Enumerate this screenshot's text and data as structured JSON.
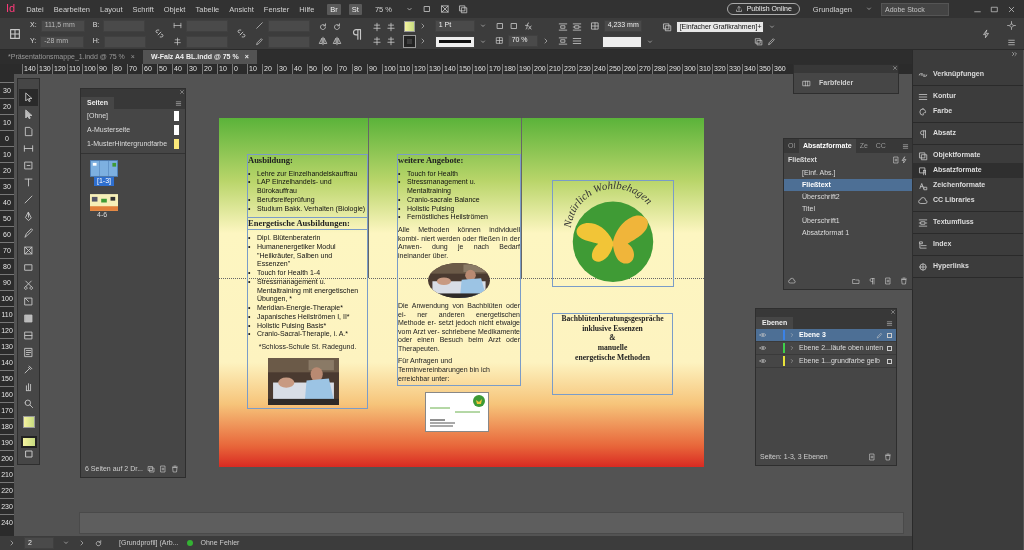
{
  "menu_bar": {
    "app_icon": "Id",
    "menus": [
      "Datei",
      "Bearbeiten",
      "Layout",
      "Schrift",
      "Objekt",
      "Tabelle",
      "Ansicht",
      "Fenster",
      "Hilfe"
    ],
    "bridge": "Br",
    "stock": "St",
    "zoom": "75 %",
    "publish": "Publish Online",
    "workspace": "Grundlagen",
    "search_placeholder": "Adobe Stock"
  },
  "control_bar": {
    "x_label": "X:",
    "x_value": "111,5 mm",
    "y_label": "Y:",
    "y_value": "-28 mm",
    "w_label": "B:",
    "h_label": "H:",
    "fields_disabled": true,
    "stroke_weight": "1 Pt",
    "opacity": "70 %",
    "offset": "4,233 mm",
    "object_style": "[Einfacher Grafikrahmen]+"
  },
  "document_tabs": [
    {
      "label": "*Präsentationsmappe_1.indd @ 75 %",
      "close": "×",
      "selected": false
    },
    {
      "label": "W-Falz A4 BL.indd @ 75 %",
      "close": "×",
      "selected": true
    }
  ],
  "rulers": {
    "horizontal": [
      "140",
      "130",
      "120",
      "110",
      "100",
      "90",
      "80",
      "70",
      "60",
      "50",
      "40",
      "30",
      "20",
      "10",
      "0",
      "10",
      "20",
      "30",
      "40",
      "50",
      "60",
      "70",
      "80",
      "90",
      "100",
      "110",
      "120",
      "130",
      "140",
      "150",
      "160",
      "170",
      "180",
      "190",
      "200",
      "210",
      "220",
      "230",
      "240",
      "250",
      "260",
      "270",
      "280",
      "290",
      "300",
      "310",
      "320",
      "330",
      "340",
      "350",
      "360"
    ],
    "vertical": [
      "30",
      "20",
      "10",
      "0",
      "10",
      "20",
      "30",
      "40",
      "50",
      "60",
      "70",
      "80",
      "90",
      "100",
      "110",
      "120",
      "130",
      "140",
      "150",
      "160",
      "170",
      "180",
      "190",
      "200",
      "210",
      "220",
      "230",
      "240"
    ]
  },
  "tools": [
    {
      "kind": "pointer",
      "selected": true
    },
    {
      "kind": "pointer-solid",
      "selected": false
    },
    {
      "kind": "page",
      "selected": false
    },
    {
      "kind": "gap",
      "selected": false
    },
    {
      "kind": "content",
      "selected": false
    },
    {
      "kind": "type",
      "selected": false
    },
    {
      "kind": "line",
      "selected": false
    },
    {
      "kind": "pen",
      "selected": false
    },
    {
      "kind": "pencil",
      "selected": false
    },
    {
      "kind": "frame",
      "selected": false
    },
    {
      "kind": "rect",
      "selected": false
    },
    {
      "kind": "scissors",
      "selected": false
    },
    {
      "kind": "transform",
      "selected": false
    },
    {
      "kind": "gradient",
      "selected": false
    },
    {
      "kind": "feather",
      "selected": false
    },
    {
      "kind": "note",
      "selected": false
    },
    {
      "kind": "eyedropper",
      "selected": false
    },
    {
      "kind": "hand",
      "selected": false
    },
    {
      "kind": "zoom",
      "selected": false
    }
  ],
  "pages_panel": {
    "tab": "Seiten",
    "masters": [
      {
        "label": "[Ohne]",
        "color": "#ffffff"
      },
      {
        "label": "A-Musterseite",
        "color": "#ffffff"
      },
      {
        "label": "1-MusterHintergrundfarbe",
        "color": "#fce97a"
      }
    ],
    "spreads": [
      {
        "label": "[1-3]",
        "selected": true
      },
      {
        "label": "4-6",
        "selected": false
      }
    ],
    "footer": "6 Seiten auf 2 Dr..."
  },
  "document": {
    "bullet": "•",
    "left_column": {
      "heading": "Ausbildung:",
      "items": [
        "Lehre zur Einzelhandelskauffrau",
        "LAP Einzelhandels- und Bürokauffrau",
        "Berufsreifeprüfung",
        "Studium Bakk. Verhalten (Biologie)"
      ],
      "heading_2": "Energetische Ausbildungen:",
      "items_2": [
        "Dipl. Blütenberaterin",
        "Humanenergetiker Modul \"Heilkräuter, Salben und Essenzen\"",
        "Touch for Health 1-4",
        "Stressmanagement u. Mentaltraining mit energetischen Übungen, *",
        "Meridian-Energie-Therapie*",
        "Japanisches Heilströmen I, II*",
        "Holistic Pulsing Basis*",
        "Cranio-Sacral-Therapie, i. A.*"
      ],
      "note": "*Schloss-Schule St. Radegund."
    },
    "middle_column": {
      "heading": "weitere Angebote:",
      "items": [
        "Touch for Health",
        "Stressmanagement u. Mentaltraining",
        "Cranio-sacrale Balance",
        "Holistic Pulsing",
        "Fernöstliches Heilströmen"
      ],
      "paragraph_1": "Alle Methoden können individuell kombi- niert werden oder fließen in der Anwen- dung je nach Bedarf ineinander über.",
      "paragraph_2": "Die Anwendung von Bachblüten oder ei- ner anderen energetischen Methode er- setzt jedoch nicht etwaige vom Arzt ver- schriebene Medikamente oder einen Besuch beim Arzt oder Therapeuten.",
      "paragraph_3": "Für Anfragen und Terminvereinbarungen bin ich erreichbar unter:"
    },
    "logo_text": "Natürlich Wohlbehagen",
    "offer_lines": [
      "Bachblütenberatungsgespräche",
      "inklusive Essenzen",
      "&",
      "manuelle",
      "energetische Methoden"
    ]
  },
  "swatches_panel": {
    "label": "Farbfelder"
  },
  "paragraph_styles_panel": {
    "tabs": [
      {
        "label": "Ol",
        "selected": false
      },
      {
        "label": "Absatzformate",
        "selected": true
      },
      {
        "label": "Ze",
        "selected": false
      },
      {
        "label": "CC",
        "selected": false
      }
    ],
    "current": "Fließtext",
    "styles": [
      {
        "label": "[Einf. Abs.]",
        "selected": false
      },
      {
        "label": "Fließtext",
        "selected": true
      },
      {
        "label": "Überschrift2",
        "selected": false
      },
      {
        "label": "Titel",
        "selected": false
      },
      {
        "label": "Überschrift1",
        "selected": false
      },
      {
        "label": "Absatzformat 1",
        "selected": false
      }
    ]
  },
  "layers_panel": {
    "tab": "Ebenen",
    "layers": [
      {
        "label": "Ebene 3",
        "color": "#3b82e6",
        "selected": true,
        "visible": true
      },
      {
        "label": "Ebene 2...läufe oben unten",
        "color": "#3ed04a",
        "selected": false,
        "visible": true
      },
      {
        "label": "Ebene 1...grundfarbe gelb",
        "color": "#e8e33a",
        "selected": false,
        "visible": true
      }
    ],
    "footer": "Seiten: 1-3, 3 Ebenen"
  },
  "dock": {
    "groups": [
      {
        "items": [
          {
            "label": "Verknüpfungen",
            "kind": "links",
            "selected": false
          }
        ]
      },
      {
        "items": [
          {
            "label": "Kontur",
            "kind": "stroke",
            "selected": false
          },
          {
            "label": "Farbe",
            "kind": "color",
            "selected": false
          }
        ]
      },
      {
        "items": [
          {
            "label": "Absatz",
            "kind": "paragraph",
            "selected": false
          }
        ]
      },
      {
        "items": [
          {
            "label": "Objektformate",
            "kind": "objectstyles",
            "selected": false
          },
          {
            "label": "Absatzformate",
            "kind": "parastyles",
            "selected": true
          },
          {
            "label": "Zeichenformate",
            "kind": "charstyles",
            "selected": false
          },
          {
            "label": "CC Libraries",
            "kind": "cloud",
            "selected": false
          }
        ]
      },
      {
        "items": [
          {
            "label": "Textumfluss",
            "kind": "textwrap",
            "selected": false
          }
        ]
      },
      {
        "items": [
          {
            "label": "Index",
            "kind": "index",
            "selected": false
          }
        ]
      },
      {
        "items": [
          {
            "label": "Hyperlinks",
            "kind": "hyperlinks",
            "selected": false
          }
        ]
      }
    ]
  },
  "status_bar": {
    "page": "2",
    "profile": "[Grundprofil] (Arb...",
    "preflight": "Ohne Fehler",
    "preflight_ok": true
  }
}
